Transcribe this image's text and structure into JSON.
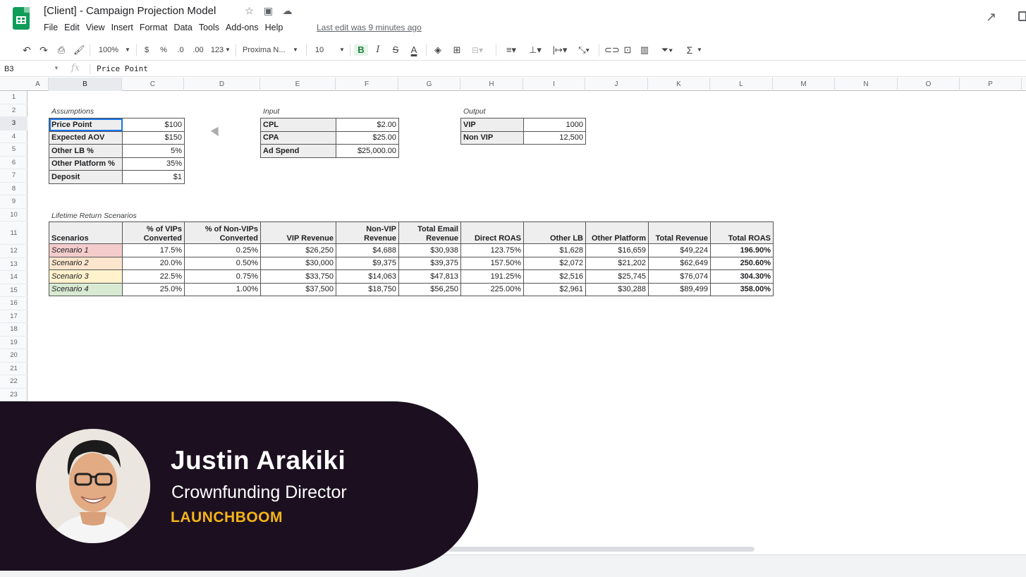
{
  "header": {
    "doc_title": "[Client] - Campaign Projection Model",
    "menu": [
      "File",
      "Edit",
      "View",
      "Insert",
      "Format",
      "Data",
      "Tools",
      "Add-ons",
      "Help"
    ],
    "last_edit": "Last edit was 9 minutes ago"
  },
  "toolbar": {
    "zoom": "100%",
    "currency": "$",
    "percent": "%",
    "dec_decrease": ".0",
    "dec_increase": ".00",
    "more_formats": "123",
    "font": "Proxima N...",
    "font_size": "10",
    "bold": "B",
    "italic": "I",
    "strike": "S",
    "text_color": "A",
    "sum": "Σ"
  },
  "formula_bar": {
    "cell_ref": "B3",
    "fx": "fx",
    "value": "Price Point"
  },
  "columns": [
    "A",
    "B",
    "C",
    "D",
    "E",
    "F",
    "G",
    "H",
    "I",
    "J",
    "K",
    "L",
    "M",
    "N",
    "O",
    "P"
  ],
  "rows": [
    "1",
    "2",
    "3",
    "4",
    "5",
    "6",
    "7",
    "8",
    "9",
    "10",
    "11",
    "12",
    "13",
    "14",
    "15",
    "16",
    "17",
    "18",
    "19",
    "20",
    "21",
    "22",
    "23"
  ],
  "assumptions": {
    "label": "Assumptions",
    "rows": [
      {
        "label": "Price Point",
        "value": "$100"
      },
      {
        "label": "Expected AOV",
        "value": "$150"
      },
      {
        "label": "Other LB %",
        "value": "5%"
      },
      {
        "label": "Other Platform %",
        "value": "35%"
      },
      {
        "label": "Deposit",
        "value": "$1"
      }
    ]
  },
  "input": {
    "label": "Input",
    "rows": [
      {
        "label": "CPL",
        "value": "$2.00"
      },
      {
        "label": "CPA",
        "value": "$25.00"
      },
      {
        "label": "Ad Spend",
        "value": "$25,000.00"
      }
    ]
  },
  "output": {
    "label": "Output",
    "rows": [
      {
        "label": "VIP",
        "value": "1000"
      },
      {
        "label": "Non VIP",
        "value": "12,500"
      }
    ]
  },
  "scenarios": {
    "label": "Lifetime Return Scenarios",
    "headers": [
      "Scenarios",
      "% of VIPs Converted",
      "% of Non-VIPs Converted",
      "VIP Revenue",
      "Non-VIP Revenue",
      "Total Email Revenue",
      "Direct ROAS",
      "Other LB",
      "Other Platform",
      "Total Revenue",
      "Total ROAS"
    ],
    "rows": [
      {
        "name": "Scenario 1",
        "color": "#f4cccc",
        "values": [
          "17.5%",
          "0.25%",
          "$26,250",
          "$4,688",
          "$30,938",
          "123.75%",
          "$1,628",
          "$16,659",
          "$49,224",
          "196.90%"
        ]
      },
      {
        "name": "Scenario 2",
        "color": "#fce5cd",
        "values": [
          "20.0%",
          "0.50%",
          "$30,000",
          "$9,375",
          "$39,375",
          "157.50%",
          "$2,072",
          "$21,202",
          "$62,649",
          "250.60%"
        ]
      },
      {
        "name": "Scenario 3",
        "color": "#fff2cc",
        "values": [
          "22.5%",
          "0.75%",
          "$33,750",
          "$14,063",
          "$47,813",
          "191.25%",
          "$2,516",
          "$25,745",
          "$76,074",
          "304.30%"
        ]
      },
      {
        "name": "Scenario 4",
        "color": "#d9ead3",
        "values": [
          "25.0%",
          "1.00%",
          "$37,500",
          "$18,750",
          "$56,250",
          "225.00%",
          "$2,961",
          "$30,288",
          "$89,499",
          "358.00%"
        ]
      }
    ]
  },
  "presenter": {
    "name": "Justin Arakiki",
    "title": "Crownfunding Director",
    "brand": "LAUNCHBOOM",
    "brand_color": "#f4b41a",
    "banner_color": "#1c1020"
  }
}
